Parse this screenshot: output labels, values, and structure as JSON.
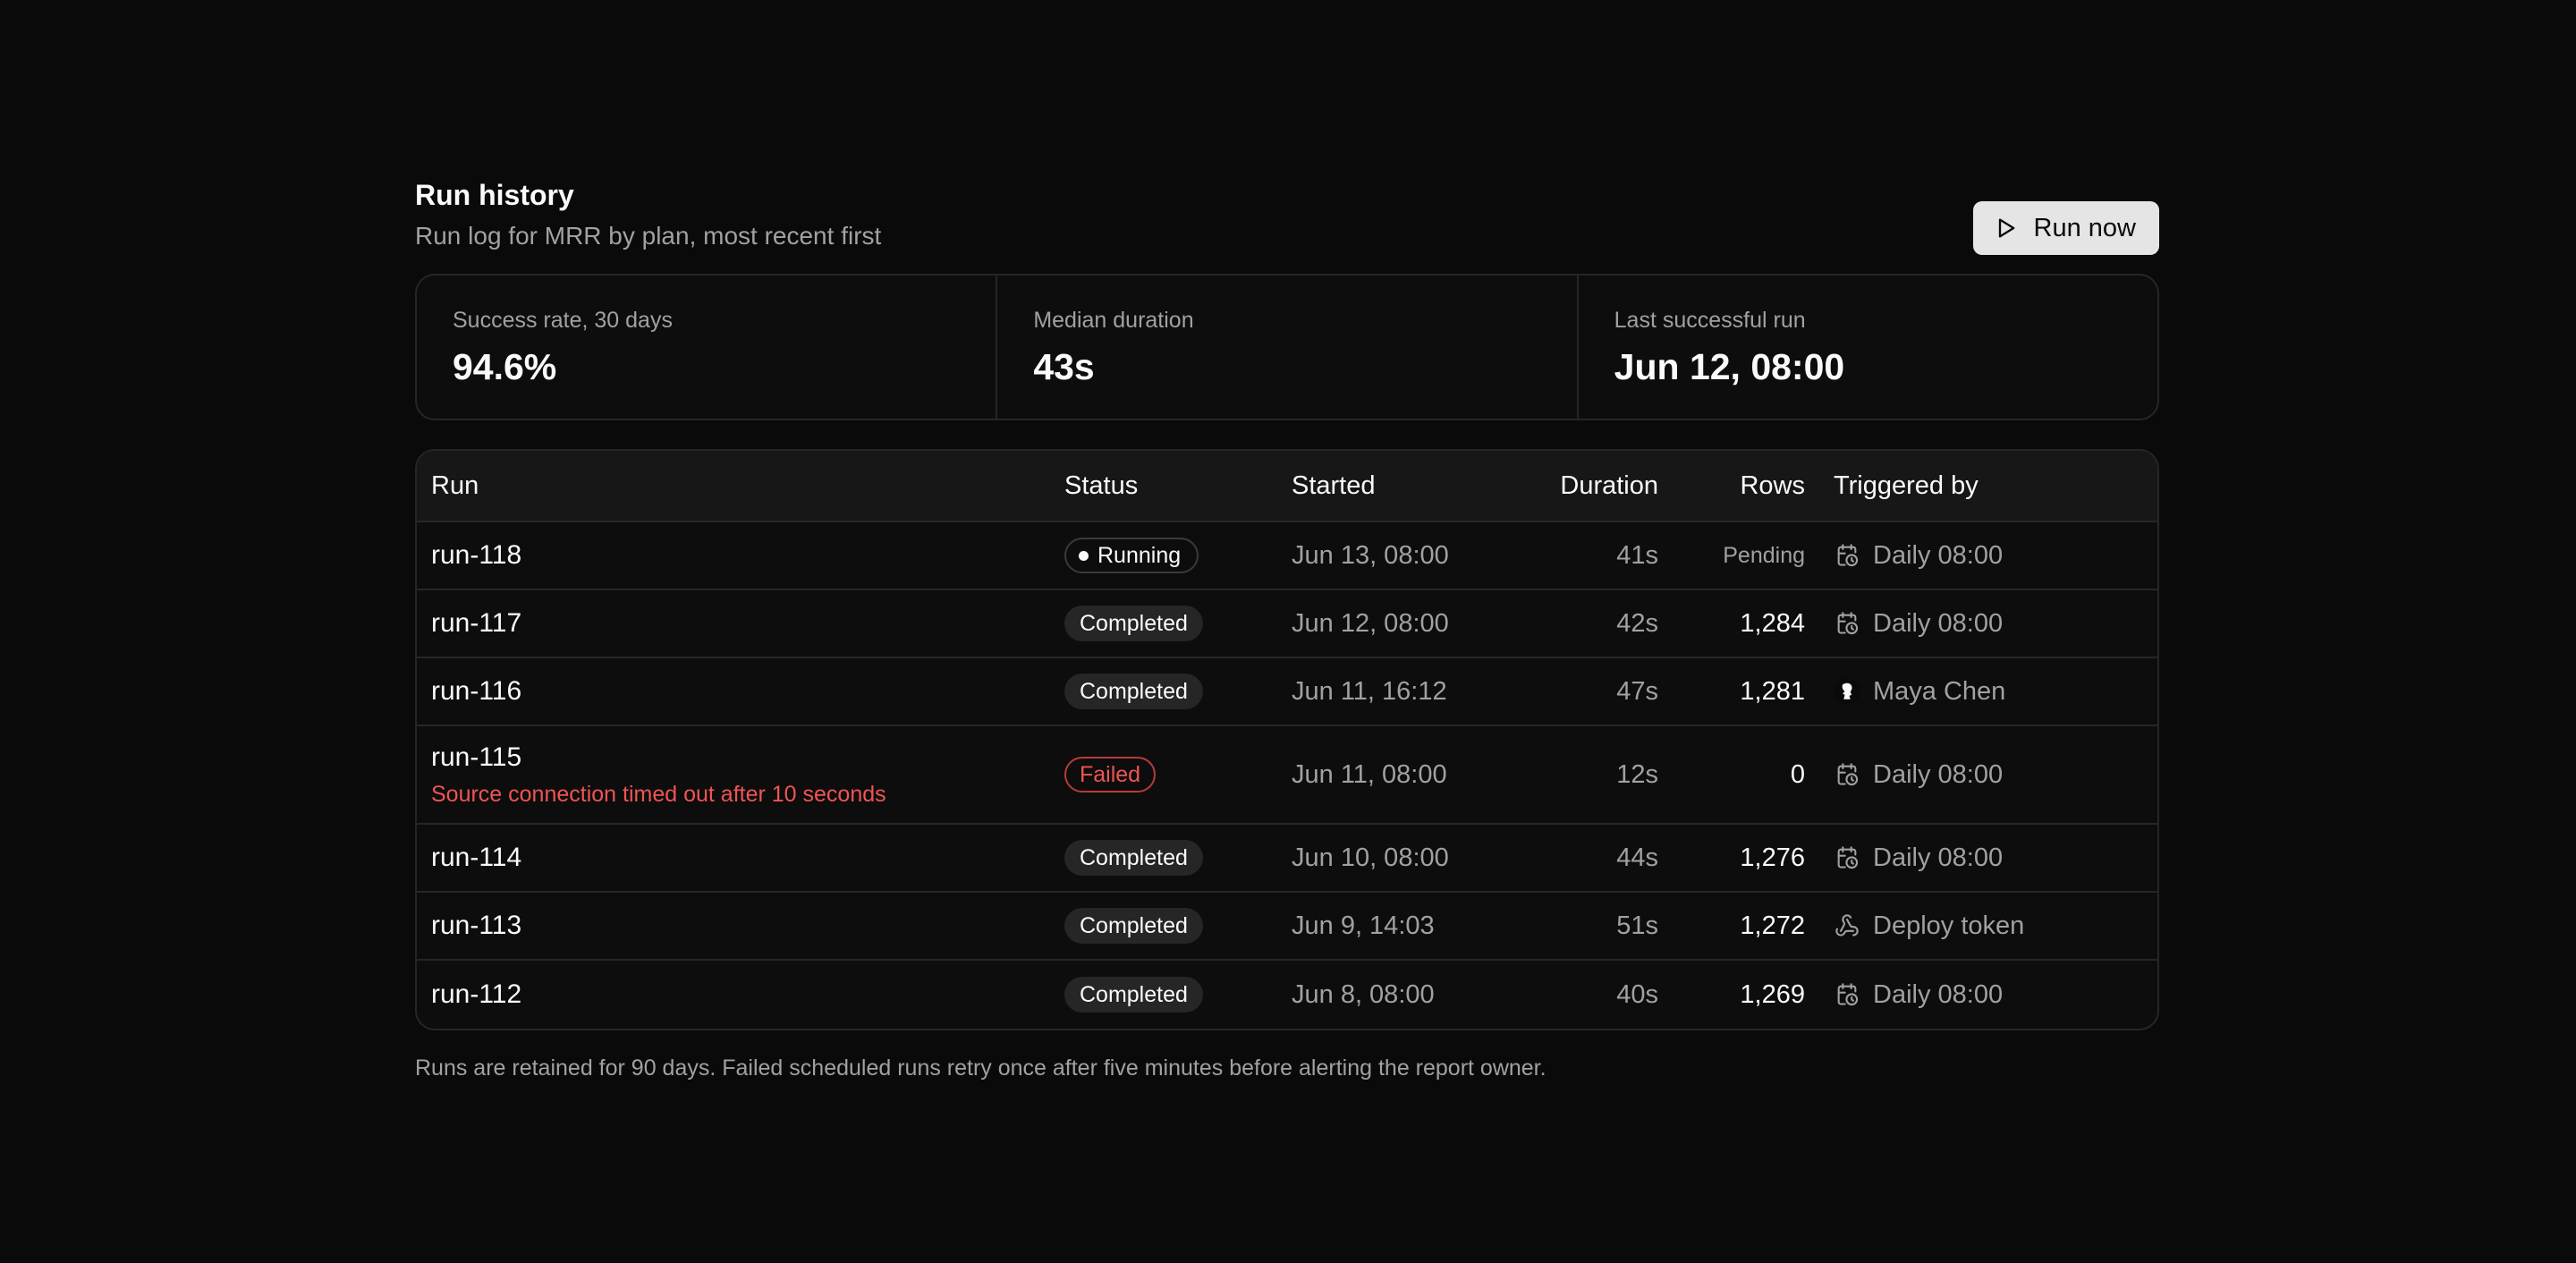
{
  "header": {
    "title": "Run history",
    "subtitle": "Run log for MRR by plan, most recent first",
    "run_now_label": "Run now",
    "run_now_icon": "play-icon"
  },
  "stats": [
    {
      "label": "Success rate, 30 days",
      "value": "94.6%"
    },
    {
      "label": "Median duration",
      "value": "43s"
    },
    {
      "label": "Last successful run",
      "value": "Jun 12, 08:00"
    }
  ],
  "table": {
    "columns": [
      "Run",
      "Status",
      "Started",
      "Duration",
      "Rows",
      "Triggered by"
    ],
    "rows": [
      {
        "run": "run-118",
        "error": "",
        "status": "Running",
        "started": "Jun 13, 08:00",
        "duration": "41s",
        "rows": "Pending",
        "trigger": "Daily 08:00",
        "trigger_icon": "calendar-clock-icon"
      },
      {
        "run": "run-117",
        "error": "",
        "status": "Completed",
        "started": "Jun 12, 08:00",
        "duration": "42s",
        "rows": "1,284",
        "trigger": "Daily 08:00",
        "trigger_icon": "calendar-clock-icon"
      },
      {
        "run": "run-116",
        "error": "",
        "status": "Completed",
        "started": "Jun 11, 16:12",
        "duration": "47s",
        "rows": "1,281",
        "trigger": "Maya Chen",
        "trigger_icon": "avatar"
      },
      {
        "run": "run-115",
        "error": "Source connection timed out after 10 seconds",
        "status": "Failed",
        "started": "Jun 11, 08:00",
        "duration": "12s",
        "rows": "0",
        "trigger": "Daily 08:00",
        "trigger_icon": "calendar-clock-icon"
      },
      {
        "run": "run-114",
        "error": "",
        "status": "Completed",
        "started": "Jun 10, 08:00",
        "duration": "44s",
        "rows": "1,276",
        "trigger": "Daily 08:00",
        "trigger_icon": "calendar-clock-icon"
      },
      {
        "run": "run-113",
        "error": "",
        "status": "Completed",
        "started": "Jun 9, 14:03",
        "duration": "51s",
        "rows": "1,272",
        "trigger": "Deploy token",
        "trigger_icon": "webhook-icon"
      },
      {
        "run": "run-112",
        "error": "",
        "status": "Completed",
        "started": "Jun 8, 08:00",
        "duration": "40s",
        "rows": "1,269",
        "trigger": "Daily 08:00",
        "trigger_icon": "calendar-clock-icon"
      }
    ]
  },
  "footnote": "Runs are retained for 90 days. Failed scheduled runs retry once after five minutes before alerting the report owner.",
  "colors": {
    "background": "#0a0a0a",
    "error": "#f05454",
    "muted": "#a1a1a1"
  }
}
